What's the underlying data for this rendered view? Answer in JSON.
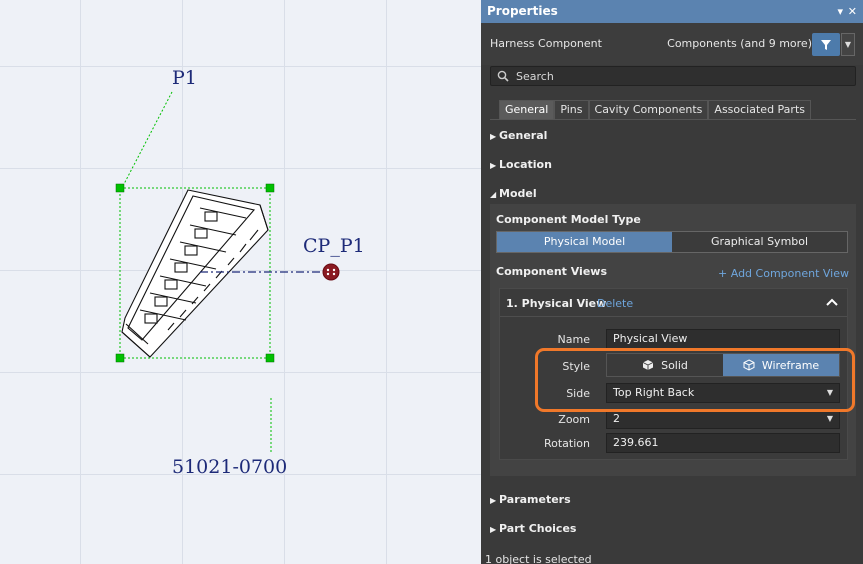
{
  "canvas": {
    "ref_designator": "P1",
    "pin_label": "CP_P1",
    "part_number": "51021-0700"
  },
  "panel": {
    "title": "Properties",
    "object_kind": "Harness Component",
    "scope": "Components (and 9 more)",
    "search_placeholder": "Search",
    "tabs": [
      "General",
      "Pins",
      "Cavity Components",
      "Associated Parts"
    ],
    "active_tab": "General",
    "sections": {
      "general": "General",
      "location": "Location",
      "model": "Model",
      "parameters": "Parameters",
      "part_choices": "Part Choices"
    },
    "model": {
      "model_type_label": "Component Model Type",
      "model_types": [
        "Physical Model",
        "Graphical Symbol"
      ],
      "selected_model_type": "Physical Model",
      "views_label": "Component Views",
      "add_view": "+ Add Component View",
      "view": {
        "header": "1. Physical View",
        "delete": "Delete",
        "name_label": "Name",
        "name_value": "Physical View",
        "style_label": "Style",
        "style_options": [
          "Solid",
          "Wireframe"
        ],
        "style_selected": "Wireframe",
        "side_label": "Side",
        "side_value": "Top Right Back",
        "zoom_label": "Zoom",
        "zoom_value": "2",
        "rotation_label": "Rotation",
        "rotation_value": "239.661"
      }
    },
    "status": "1 object is selected"
  },
  "colors": {
    "accent": "#5b83b0",
    "link": "#6fa6dd",
    "highlight": "#f0782a",
    "selection_handle": "#00c800"
  }
}
